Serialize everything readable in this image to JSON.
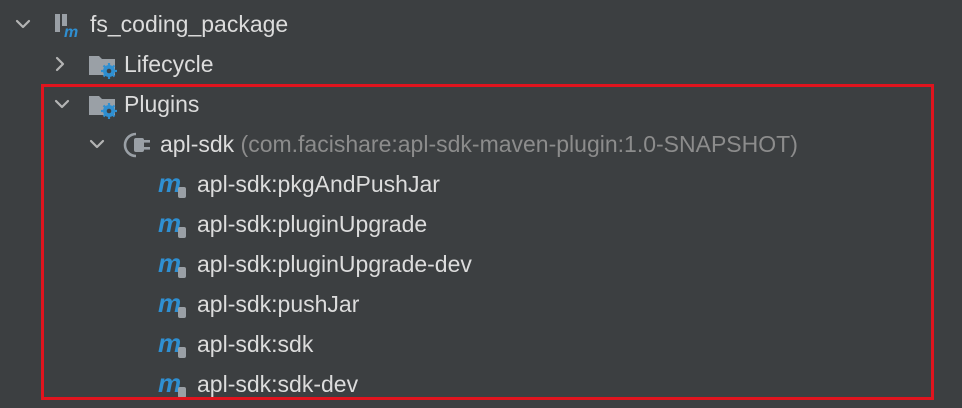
{
  "tree": {
    "root": {
      "label": "fs_coding_package",
      "expanded": true,
      "icon": "maven-module-icon"
    },
    "lifecycle": {
      "label": "Lifecycle",
      "expanded": false,
      "icon": "settings-folder-icon"
    },
    "plugins": {
      "label": "Plugins",
      "expanded": true,
      "icon": "settings-folder-icon"
    },
    "plugin": {
      "label": "apl-sdk",
      "coords": "(com.facishare:apl-sdk-maven-plugin:1.0-SNAPSHOT)",
      "expanded": true,
      "icon": "plugin-icon"
    },
    "goals": [
      {
        "label": "apl-sdk:pkgAndPushJar",
        "icon": "maven-goal-icon"
      },
      {
        "label": "apl-sdk:pluginUpgrade",
        "icon": "maven-goal-icon"
      },
      {
        "label": "apl-sdk:pluginUpgrade-dev",
        "icon": "maven-goal-icon"
      },
      {
        "label": "apl-sdk:pushJar",
        "icon": "maven-goal-icon"
      },
      {
        "label": "apl-sdk:sdk",
        "icon": "maven-goal-icon"
      },
      {
        "label": "apl-sdk:sdk-dev",
        "icon": "maven-goal-icon"
      }
    ]
  },
  "colors": {
    "background": "#3c3f41",
    "text": "#dcdcdc",
    "secondary_text": "#8c8c8c",
    "maven_blue": "#2f8fd1",
    "highlight_border": "#e0141e"
  }
}
